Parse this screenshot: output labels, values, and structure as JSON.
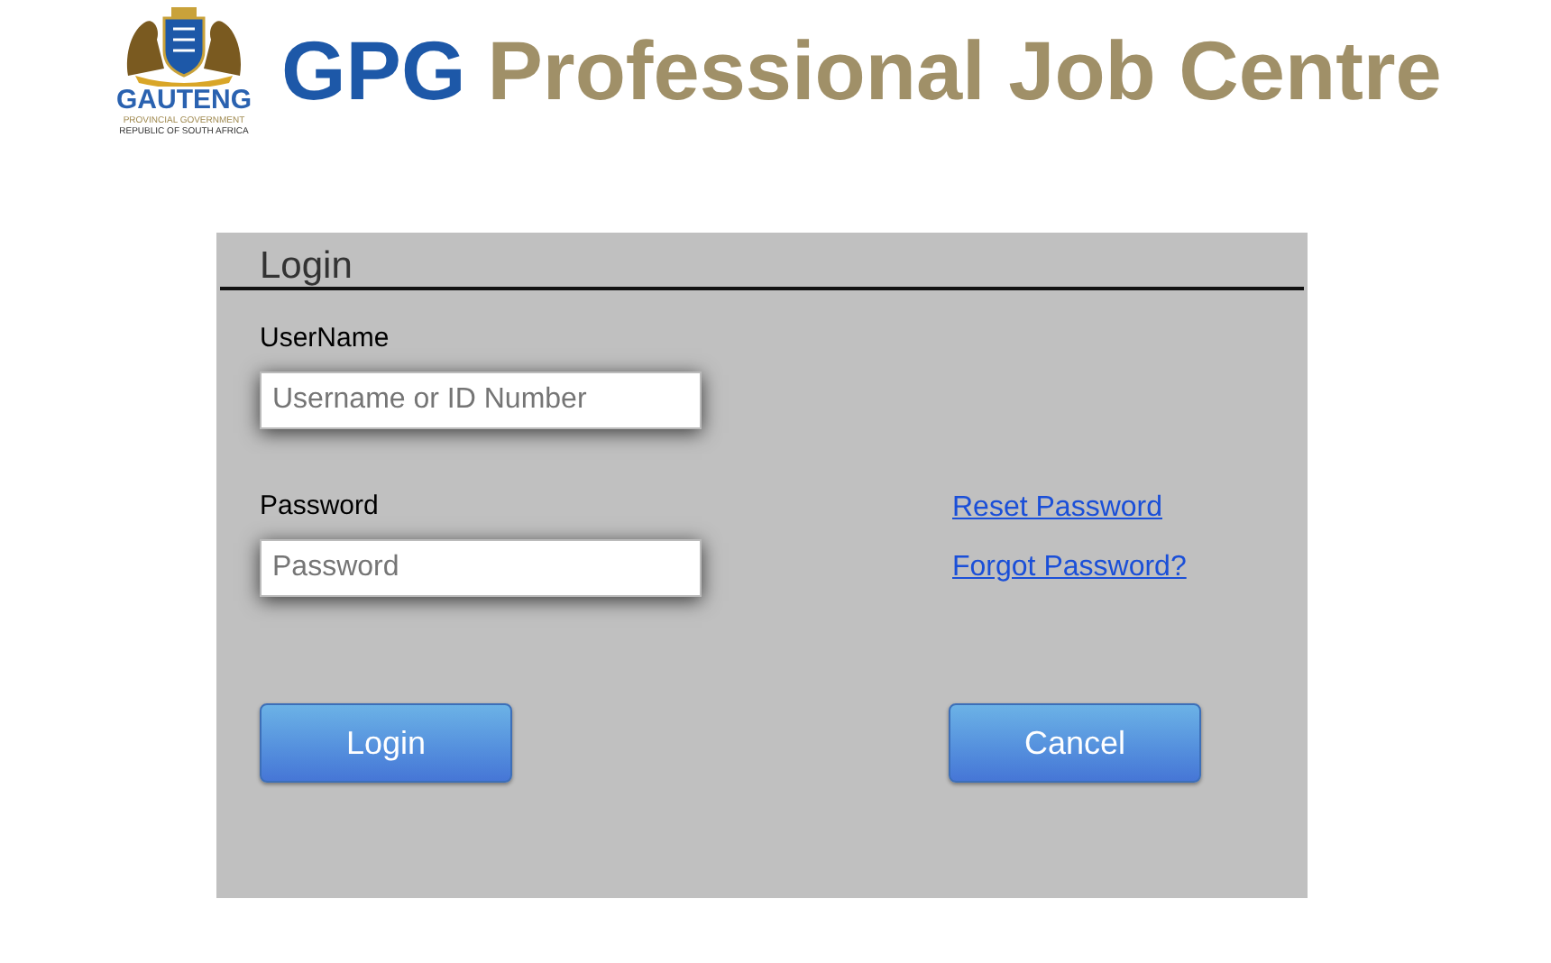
{
  "logo": {
    "name": "GAUTENG",
    "line_1": "PROVINCIAL GOVERNMENT",
    "line_2": "REPUBLIC OF SOUTH AFRICA"
  },
  "header": {
    "brand": "GPG",
    "title": "Professional Job Centre"
  },
  "login": {
    "title": "Login",
    "username": {
      "label": "UserName",
      "placeholder": "Username or ID Number"
    },
    "password": {
      "label": "Password",
      "placeholder": "Password"
    },
    "links": [
      "Reset Password",
      "Forgot Password?"
    ],
    "buttons": [
      "Login",
      "Cancel"
    ]
  }
}
